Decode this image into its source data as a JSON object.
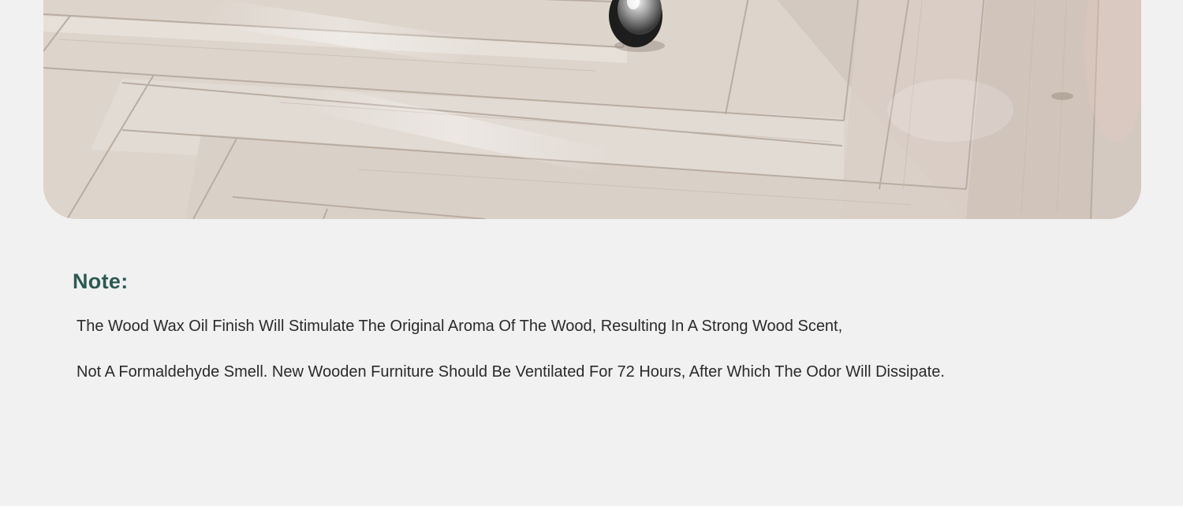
{
  "note": {
    "title": "Note:",
    "lines": [
      "The Wood Wax Oil Finish Will Stimulate The Original Aroma Of The Wood, Resulting In A Strong Wood Scent,",
      "Not A Formaldehyde Smell. New Wooden Furniture Should Be Ventilated For 72 Hours, After Which The Odor Will Dissipate."
    ]
  },
  "colors": {
    "page_background": "#f1f1f1",
    "title_color": "#2c5a52",
    "text_color": "#2a2a2a",
    "floor_tone": "#ded6cf"
  }
}
